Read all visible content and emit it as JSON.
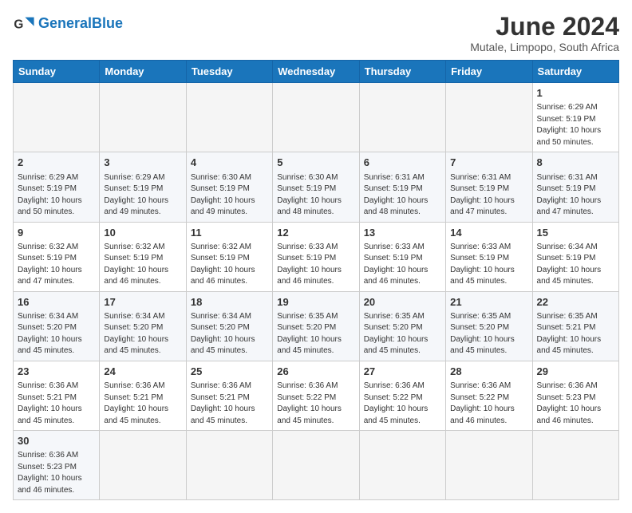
{
  "header": {
    "logo_general": "General",
    "logo_blue": "Blue",
    "month_title": "June 2024",
    "subtitle": "Mutale, Limpopo, South Africa"
  },
  "weekdays": [
    "Sunday",
    "Monday",
    "Tuesday",
    "Wednesday",
    "Thursday",
    "Friday",
    "Saturday"
  ],
  "weeks": [
    [
      {
        "day": "",
        "info": ""
      },
      {
        "day": "",
        "info": ""
      },
      {
        "day": "",
        "info": ""
      },
      {
        "day": "",
        "info": ""
      },
      {
        "day": "",
        "info": ""
      },
      {
        "day": "",
        "info": ""
      },
      {
        "day": "1",
        "info": "Sunrise: 6:29 AM\nSunset: 5:19 PM\nDaylight: 10 hours\nand 50 minutes."
      }
    ],
    [
      {
        "day": "2",
        "info": "Sunrise: 6:29 AM\nSunset: 5:19 PM\nDaylight: 10 hours\nand 50 minutes."
      },
      {
        "day": "3",
        "info": "Sunrise: 6:29 AM\nSunset: 5:19 PM\nDaylight: 10 hours\nand 49 minutes."
      },
      {
        "day": "4",
        "info": "Sunrise: 6:30 AM\nSunset: 5:19 PM\nDaylight: 10 hours\nand 49 minutes."
      },
      {
        "day": "5",
        "info": "Sunrise: 6:30 AM\nSunset: 5:19 PM\nDaylight: 10 hours\nand 48 minutes."
      },
      {
        "day": "6",
        "info": "Sunrise: 6:31 AM\nSunset: 5:19 PM\nDaylight: 10 hours\nand 48 minutes."
      },
      {
        "day": "7",
        "info": "Sunrise: 6:31 AM\nSunset: 5:19 PM\nDaylight: 10 hours\nand 47 minutes."
      },
      {
        "day": "8",
        "info": "Sunrise: 6:31 AM\nSunset: 5:19 PM\nDaylight: 10 hours\nand 47 minutes."
      }
    ],
    [
      {
        "day": "9",
        "info": "Sunrise: 6:32 AM\nSunset: 5:19 PM\nDaylight: 10 hours\nand 47 minutes."
      },
      {
        "day": "10",
        "info": "Sunrise: 6:32 AM\nSunset: 5:19 PM\nDaylight: 10 hours\nand 46 minutes."
      },
      {
        "day": "11",
        "info": "Sunrise: 6:32 AM\nSunset: 5:19 PM\nDaylight: 10 hours\nand 46 minutes."
      },
      {
        "day": "12",
        "info": "Sunrise: 6:33 AM\nSunset: 5:19 PM\nDaylight: 10 hours\nand 46 minutes."
      },
      {
        "day": "13",
        "info": "Sunrise: 6:33 AM\nSunset: 5:19 PM\nDaylight: 10 hours\nand 46 minutes."
      },
      {
        "day": "14",
        "info": "Sunrise: 6:33 AM\nSunset: 5:19 PM\nDaylight: 10 hours\nand 45 minutes."
      },
      {
        "day": "15",
        "info": "Sunrise: 6:34 AM\nSunset: 5:19 PM\nDaylight: 10 hours\nand 45 minutes."
      }
    ],
    [
      {
        "day": "16",
        "info": "Sunrise: 6:34 AM\nSunset: 5:20 PM\nDaylight: 10 hours\nand 45 minutes."
      },
      {
        "day": "17",
        "info": "Sunrise: 6:34 AM\nSunset: 5:20 PM\nDaylight: 10 hours\nand 45 minutes."
      },
      {
        "day": "18",
        "info": "Sunrise: 6:34 AM\nSunset: 5:20 PM\nDaylight: 10 hours\nand 45 minutes."
      },
      {
        "day": "19",
        "info": "Sunrise: 6:35 AM\nSunset: 5:20 PM\nDaylight: 10 hours\nand 45 minutes."
      },
      {
        "day": "20",
        "info": "Sunrise: 6:35 AM\nSunset: 5:20 PM\nDaylight: 10 hours\nand 45 minutes."
      },
      {
        "day": "21",
        "info": "Sunrise: 6:35 AM\nSunset: 5:20 PM\nDaylight: 10 hours\nand 45 minutes."
      },
      {
        "day": "22",
        "info": "Sunrise: 6:35 AM\nSunset: 5:21 PM\nDaylight: 10 hours\nand 45 minutes."
      }
    ],
    [
      {
        "day": "23",
        "info": "Sunrise: 6:36 AM\nSunset: 5:21 PM\nDaylight: 10 hours\nand 45 minutes."
      },
      {
        "day": "24",
        "info": "Sunrise: 6:36 AM\nSunset: 5:21 PM\nDaylight: 10 hours\nand 45 minutes."
      },
      {
        "day": "25",
        "info": "Sunrise: 6:36 AM\nSunset: 5:21 PM\nDaylight: 10 hours\nand 45 minutes."
      },
      {
        "day": "26",
        "info": "Sunrise: 6:36 AM\nSunset: 5:22 PM\nDaylight: 10 hours\nand 45 minutes."
      },
      {
        "day": "27",
        "info": "Sunrise: 6:36 AM\nSunset: 5:22 PM\nDaylight: 10 hours\nand 45 minutes."
      },
      {
        "day": "28",
        "info": "Sunrise: 6:36 AM\nSunset: 5:22 PM\nDaylight: 10 hours\nand 46 minutes."
      },
      {
        "day": "29",
        "info": "Sunrise: 6:36 AM\nSunset: 5:23 PM\nDaylight: 10 hours\nand 46 minutes."
      }
    ],
    [
      {
        "day": "30",
        "info": "Sunrise: 6:36 AM\nSunset: 5:23 PM\nDaylight: 10 hours\nand 46 minutes."
      },
      {
        "day": "",
        "info": ""
      },
      {
        "day": "",
        "info": ""
      },
      {
        "day": "",
        "info": ""
      },
      {
        "day": "",
        "info": ""
      },
      {
        "day": "",
        "info": ""
      },
      {
        "day": "",
        "info": ""
      }
    ]
  ]
}
